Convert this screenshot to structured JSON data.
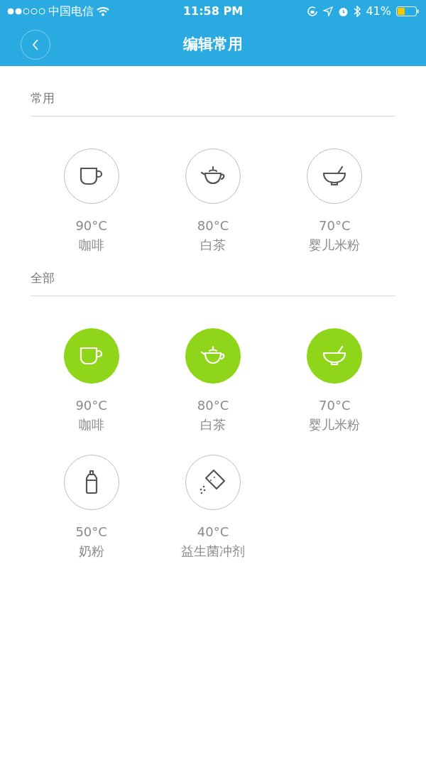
{
  "status_bar": {
    "carrier": "中国电信",
    "time": "11:58 PM",
    "battery": "41%"
  },
  "nav": {
    "title": "编辑常用"
  },
  "sections": [
    {
      "title": "常用",
      "items": [
        {
          "kind": "cup",
          "temp": "90°C",
          "name": "咖啡",
          "selected": false
        },
        {
          "kind": "teapot",
          "temp": "80°C",
          "name": "白茶",
          "selected": false
        },
        {
          "kind": "bowl",
          "temp": "70°C",
          "name": "婴儿米粉",
          "selected": false
        }
      ]
    },
    {
      "title": "全部",
      "items": [
        {
          "kind": "cup",
          "temp": "90°C",
          "name": "咖啡",
          "selected": true
        },
        {
          "kind": "teapot",
          "temp": "80°C",
          "name": "白茶",
          "selected": true
        },
        {
          "kind": "bowl",
          "temp": "70°C",
          "name": "婴儿米粉",
          "selected": true
        },
        {
          "kind": "bottle",
          "temp": "50°C",
          "name": "奶粉",
          "selected": false
        },
        {
          "kind": "sachet",
          "temp": "40°C",
          "name": "益生菌冲剂",
          "selected": false
        }
      ]
    }
  ]
}
